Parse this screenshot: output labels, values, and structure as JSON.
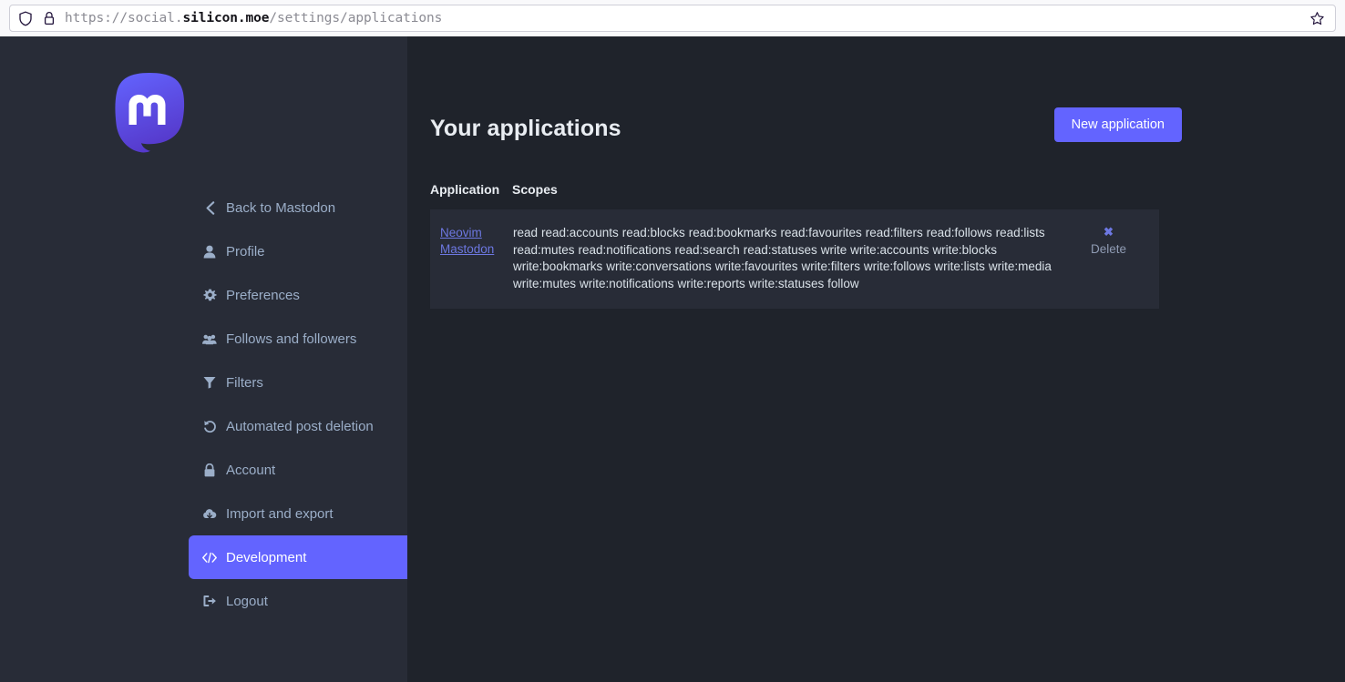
{
  "browser": {
    "shield_icon": "shield-icon",
    "lock_icon": "lock-icon",
    "url_scheme": "https://social.",
    "url_host": "silicon.moe",
    "url_path": "/settings/applications",
    "url_full": "https://social.silicon.moe/settings/applications",
    "bookmark_icon": "star-icon"
  },
  "sidebar": {
    "logo_alt": "mastodon-logo",
    "items": [
      {
        "label": "Back to Mastodon",
        "icon": "chevron-left-icon",
        "name": "back-to-mastodon",
        "active": false
      },
      {
        "label": "Profile",
        "icon": "user-icon",
        "name": "profile",
        "active": false
      },
      {
        "label": "Preferences",
        "icon": "gear-icon",
        "name": "preferences",
        "active": false
      },
      {
        "label": "Follows and followers",
        "icon": "users-icon",
        "name": "follows-and-followers",
        "active": false
      },
      {
        "label": "Filters",
        "icon": "filter-icon",
        "name": "filters",
        "active": false
      },
      {
        "label": "Automated post deletion",
        "icon": "history-icon",
        "name": "automated-post-deletion",
        "active": false
      },
      {
        "label": "Account",
        "icon": "lock-icon",
        "name": "account",
        "active": false
      },
      {
        "label": "Import and export",
        "icon": "cloud-download-icon",
        "name": "import-and-export",
        "active": false
      },
      {
        "label": "Development",
        "icon": "code-icon",
        "name": "development",
        "active": true
      },
      {
        "label": "Logout",
        "icon": "sign-out-icon",
        "name": "logout",
        "active": false
      }
    ]
  },
  "main": {
    "title": "Your applications",
    "new_application_label": "New application",
    "table": {
      "headers": {
        "application": "Application",
        "scopes": "Scopes",
        "actions": ""
      },
      "rows": [
        {
          "application": "Neovim Mastodon",
          "scopes": "read read:accounts read:blocks read:bookmarks read:favourites read:filters read:follows read:lists read:mutes read:notifications read:search read:statuses write write:accounts write:blocks write:bookmarks write:conversations write:favourites write:filters write:follows write:lists write:media write:mutes write:notifications write:reports write:statuses follow",
          "delete_label": "Delete",
          "delete_icon": "close-x-icon"
        }
      ]
    }
  },
  "colors": {
    "accent": "#6364ff",
    "sidebar_bg": "#282c37",
    "content_bg": "#1f232b",
    "link": "#6d78e2",
    "text_muted": "#9baec8"
  }
}
